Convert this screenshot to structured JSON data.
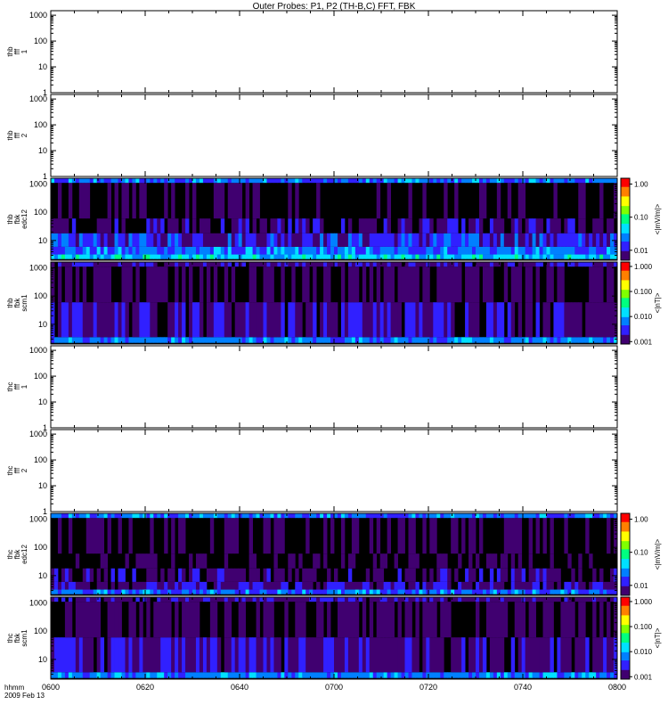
{
  "title": "Outer Probes: P1, P2 (TH-B,C) FFT, FBK",
  "xaxis": {
    "tick_labels": [
      "0600",
      "0620",
      "0640",
      "0700",
      "0720",
      "0740",
      "0800"
    ],
    "tick_values_min": [
      0,
      20,
      40,
      60,
      80,
      100,
      120
    ],
    "xlim": [
      0,
      120
    ],
    "label_lines": [
      "hhmm",
      "2009 Feb 13"
    ]
  },
  "colors": {
    "background": "#000000",
    "colormap": [
      "#400070",
      "#3020ff",
      "#0080ff",
      "#00e0ff",
      "#00ff80",
      "#80ff00",
      "#ffff00",
      "#ff8000",
      "#ff0000"
    ]
  },
  "chart_data": [
    {
      "type": "heatmap",
      "panel": "thb_fft_1",
      "ylabel_lines": [
        "thb",
        "fff",
        "1"
      ],
      "yscale": "log",
      "ylim": [
        1,
        1500
      ],
      "ytick_labels": [
        "1",
        "10",
        "100",
        "1000"
      ],
      "data": "none"
    },
    {
      "type": "heatmap",
      "panel": "thb_fft_2",
      "ylabel_lines": [
        "thb",
        "fff",
        "2"
      ],
      "yscale": "log",
      "ylim": [
        1,
        1500
      ],
      "ytick_labels": [
        "1",
        "10",
        "100",
        "1000"
      ],
      "data": "none"
    },
    {
      "type": "heatmap",
      "panel": "thb_fbk_edc12",
      "ylabel_lines": [
        "thb",
        "fbk",
        "edc12"
      ],
      "yscale": "log",
      "ylim": [
        2,
        1600
      ],
      "ytick_labels": [
        "10",
        "100",
        "1000"
      ],
      "colorbar": {
        "label": "<|mV/m|>",
        "scale": "log",
        "range": [
          0.005,
          1.5
        ],
        "tick_labels": [
          "0.01",
          "0.10",
          "1.00"
        ],
        "tick_values": [
          0.01,
          0.1,
          1.0
        ]
      },
      "bands": [
        {
          "freq_range": [
            2.2,
            3.2
          ],
          "typical_value": 0.04
        },
        {
          "freq_range": [
            3.2,
            6
          ],
          "typical_value": 0.02
        },
        {
          "freq_range": [
            6,
            18
          ],
          "typical_value": 0.012
        },
        {
          "freq_range": [
            18,
            60
          ],
          "typical_value": 0.006
        },
        {
          "freq_range": [
            60,
            1100
          ],
          "typical_value": 0.004
        },
        {
          "freq_range": [
            1100,
            1600
          ],
          "typical_value": 0.02
        }
      ]
    },
    {
      "type": "heatmap",
      "panel": "thb_fbk_scm1",
      "ylabel_lines": [
        "thb",
        "fbk",
        "scm1"
      ],
      "yscale": "log",
      "ylim": [
        2,
        1600
      ],
      "ytick_labels": [
        "10",
        "100",
        "1000"
      ],
      "colorbar": {
        "label": "<|nT|>",
        "scale": "log",
        "range": [
          0.0008,
          1.5
        ],
        "tick_labels": [
          "0.001",
          "0.010",
          "0.100",
          "1.000"
        ],
        "tick_values": [
          0.001,
          0.01,
          0.1,
          1.0
        ]
      },
      "bands": [
        {
          "freq_range": [
            2.2,
            3.5
          ],
          "typical_value": 0.006
        },
        {
          "freq_range": [
            3.5,
            60
          ],
          "typical_value": 0.0015
        },
        {
          "freq_range": [
            60,
            1100
          ],
          "typical_value": 0.0009
        },
        {
          "freq_range": [
            1100,
            1600
          ],
          "typical_value": 0.0015
        }
      ]
    },
    {
      "type": "heatmap",
      "panel": "thc_fft_1",
      "ylabel_lines": [
        "thc",
        "fff",
        "1"
      ],
      "yscale": "log",
      "ylim": [
        1,
        1500
      ],
      "ytick_labels": [
        "1",
        "10",
        "100",
        "1000"
      ],
      "data": "none"
    },
    {
      "type": "heatmap",
      "panel": "thc_fft_2",
      "ylabel_lines": [
        "thc",
        "fff",
        "2"
      ],
      "yscale": "log",
      "ylim": [
        1,
        1500
      ],
      "ytick_labels": [
        "1",
        "10",
        "100",
        "1000"
      ],
      "data": "none"
    },
    {
      "type": "heatmap",
      "panel": "thc_fbk_edc12",
      "ylabel_lines": [
        "thc",
        "fbk",
        "edc12"
      ],
      "yscale": "log",
      "ylim": [
        2,
        1600
      ],
      "ytick_labels": [
        "10",
        "100",
        "1000"
      ],
      "colorbar": {
        "label": "<|mV/m|>",
        "scale": "log",
        "range": [
          0.005,
          1.5
        ],
        "tick_labels": [
          "0.01",
          "0.10",
          "1.00"
        ],
        "tick_values": [
          0.01,
          0.1,
          1.0
        ]
      },
      "bands": [
        {
          "freq_range": [
            2.2,
            3.2
          ],
          "typical_value": 0.02
        },
        {
          "freq_range": [
            3.2,
            6
          ],
          "typical_value": 0.008
        },
        {
          "freq_range": [
            6,
            18
          ],
          "typical_value": 0.006
        },
        {
          "freq_range": [
            18,
            60
          ],
          "typical_value": 0.004
        },
        {
          "freq_range": [
            60,
            1100
          ],
          "typical_value": 0.004
        },
        {
          "freq_range": [
            1100,
            1600
          ],
          "typical_value": 0.02
        }
      ]
    },
    {
      "type": "heatmap",
      "panel": "thc_fbk_scm1",
      "ylabel_lines": [
        "thc",
        "fbk",
        "scm1"
      ],
      "yscale": "log",
      "ylim": [
        2,
        1600
      ],
      "ytick_labels": [
        "10",
        "100",
        "1000"
      ],
      "colorbar": {
        "label": "<|nT|>",
        "scale": "log",
        "range": [
          0.0008,
          1.5
        ],
        "tick_labels": [
          "0.001",
          "0.010",
          "0.100",
          "1.000"
        ],
        "tick_values": [
          0.001,
          0.01,
          0.1,
          1.0
        ]
      },
      "bands": [
        {
          "freq_range": [
            2.2,
            3.5
          ],
          "typical_value": 0.006
        },
        {
          "freq_range": [
            3.5,
            60
          ],
          "typical_value": 0.0015
        },
        {
          "freq_range": [
            60,
            1100
          ],
          "typical_value": 0.0009
        },
        {
          "freq_range": [
            1100,
            1600
          ],
          "typical_value": 0.0015
        }
      ]
    }
  ]
}
